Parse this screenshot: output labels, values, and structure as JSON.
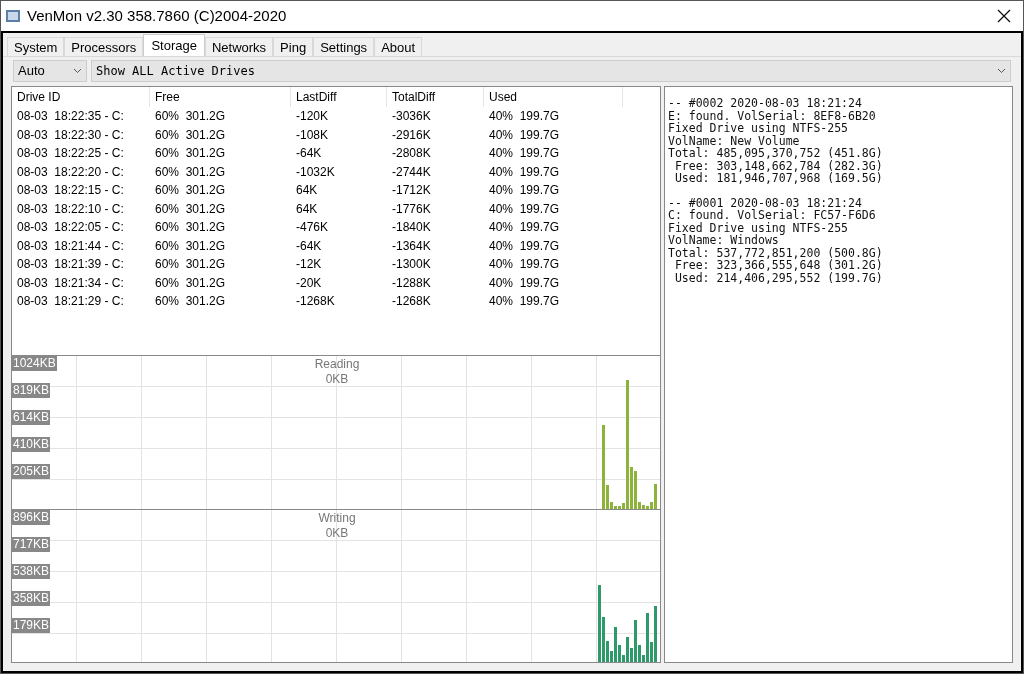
{
  "window": {
    "title": "VenMon v2.30 358.7860 (C)2004-2020"
  },
  "tabs": [
    {
      "label": "System",
      "selected": false
    },
    {
      "label": "Processors",
      "selected": false
    },
    {
      "label": "Storage",
      "selected": true
    },
    {
      "label": "Networks",
      "selected": false
    },
    {
      "label": "Ping",
      "selected": false
    },
    {
      "label": "Settings",
      "selected": false
    },
    {
      "label": "About",
      "selected": false
    }
  ],
  "toolbar": {
    "mode_dropdown": "Auto",
    "drive_dropdown": "Show ALL Active Drives"
  },
  "table": {
    "columns": [
      "Drive ID",
      "Free",
      "LastDiff",
      "TotalDiff",
      "Used"
    ],
    "rows": [
      [
        "08-03  18:22:35 - C:",
        "60%  301.2G",
        "-120K",
        "-3036K",
        "40%  199.7G"
      ],
      [
        "08-03  18:22:30 - C:",
        "60%  301.2G",
        "-108K",
        "-2916K",
        "40%  199.7G"
      ],
      [
        "08-03  18:22:25 - C:",
        "60%  301.2G",
        "-64K",
        "-2808K",
        "40%  199.7G"
      ],
      [
        "08-03  18:22:20 - C:",
        "60%  301.2G",
        "-1032K",
        "-2744K",
        "40%  199.7G"
      ],
      [
        "08-03  18:22:15 - C:",
        "60%  301.2G",
        "64K",
        "-1712K",
        "40%  199.7G"
      ],
      [
        "08-03  18:22:10 - C:",
        "60%  301.2G",
        "64K",
        "-1776K",
        "40%  199.7G"
      ],
      [
        "08-03  18:22:05 - C:",
        "60%  301.2G",
        "-476K",
        "-1840K",
        "40%  199.7G"
      ],
      [
        "08-03  18:21:44 - C:",
        "60%  301.2G",
        "-64K",
        "-1364K",
        "40%  199.7G"
      ],
      [
        "08-03  18:21:39 - C:",
        "60%  301.2G",
        "-12K",
        "-1300K",
        "40%  199.7G"
      ],
      [
        "08-03  18:21:34 - C:",
        "60%  301.2G",
        "-20K",
        "-1288K",
        "40%  199.7G"
      ],
      [
        "08-03  18:21:29 - C:",
        "60%  301.2G",
        "-1268K",
        "-1268K",
        "40%  199.7G"
      ]
    ]
  },
  "graphs": [
    {
      "title": "Reading",
      "reading": "0KB",
      "y_labels": [
        "1024KB",
        "819KB",
        "614KB",
        "410KB",
        "205KB"
      ],
      "color": "#8db33a"
    },
    {
      "title": "Writing",
      "reading": "0KB",
      "y_labels": [
        "896KB",
        "717KB",
        "538KB",
        "358KB",
        "179KB"
      ],
      "color": "#2e9a6a"
    }
  ],
  "log": [
    {
      "lines": [
        "-- #0002 2020-08-03 18:21:24",
        "E: found. VolSerial: 8EF8-6B20",
        "Fixed Drive using NTFS-255",
        "VolName: New Volume",
        "Total: 485,095,370,752 (451.8G)",
        " Free: 303,148,662,784 (282.3G)",
        " Used: 181,946,707,968 (169.5G)"
      ]
    },
    {
      "lines": [
        "-- #0001 2020-08-03 18:21:24",
        "C: found. VolSerial: FC57-F6D6",
        "Fixed Drive using NTFS-255",
        "VolName: Windows",
        "Total: 537,772,851,200 (500.8G)",
        " Free: 323,366,555,648 (301.2G)",
        " Used: 214,406,295,552 (199.7G)"
      ]
    }
  ]
}
